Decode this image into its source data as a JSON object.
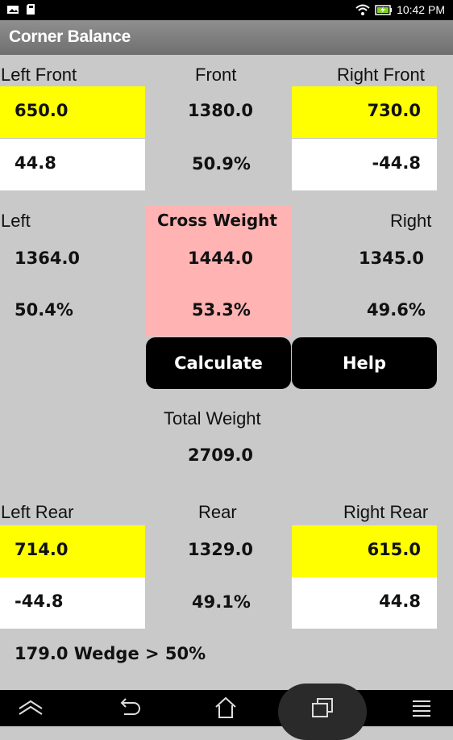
{
  "status_bar": {
    "time": "10:42 PM"
  },
  "app": {
    "title": "Corner Balance"
  },
  "front": {
    "left_label": "Left Front",
    "center_label": "Front",
    "right_label": "Right Front",
    "left_weight": "650.0",
    "center_weight": "1380.0",
    "right_weight": "730.0",
    "left_diff": "44.8",
    "center_pct": "50.9%",
    "right_diff": "-44.8"
  },
  "middle": {
    "left_label": "Left",
    "cross_label": "Cross Weight",
    "right_label": "Right",
    "left_weight": "1364.0",
    "cross_weight": "1444.0",
    "right_weight": "1345.0",
    "left_pct": "50.4%",
    "cross_pct": "53.3%",
    "right_pct": "49.6%"
  },
  "buttons": {
    "calculate": "Calculate",
    "help": "Help"
  },
  "total": {
    "label": "Total Weight",
    "value": "2709.0"
  },
  "rear": {
    "left_label": "Left Rear",
    "center_label": "Rear",
    "right_label": "Right Rear",
    "left_weight": "714.0",
    "center_weight": "1329.0",
    "right_weight": "615.0",
    "left_diff": "-44.8",
    "center_pct": "49.1%",
    "right_diff": "44.8"
  },
  "wedge": {
    "text": "179.0 Wedge > 50%"
  },
  "nav_bar": {
    "icons": [
      "chevron-up-icon",
      "back-icon",
      "home-icon",
      "recent-apps-icon",
      "menu-icon"
    ]
  },
  "colors": {
    "highlight": "#ffff00",
    "cross": "#ffb3b3",
    "background": "#c9c9c9"
  }
}
